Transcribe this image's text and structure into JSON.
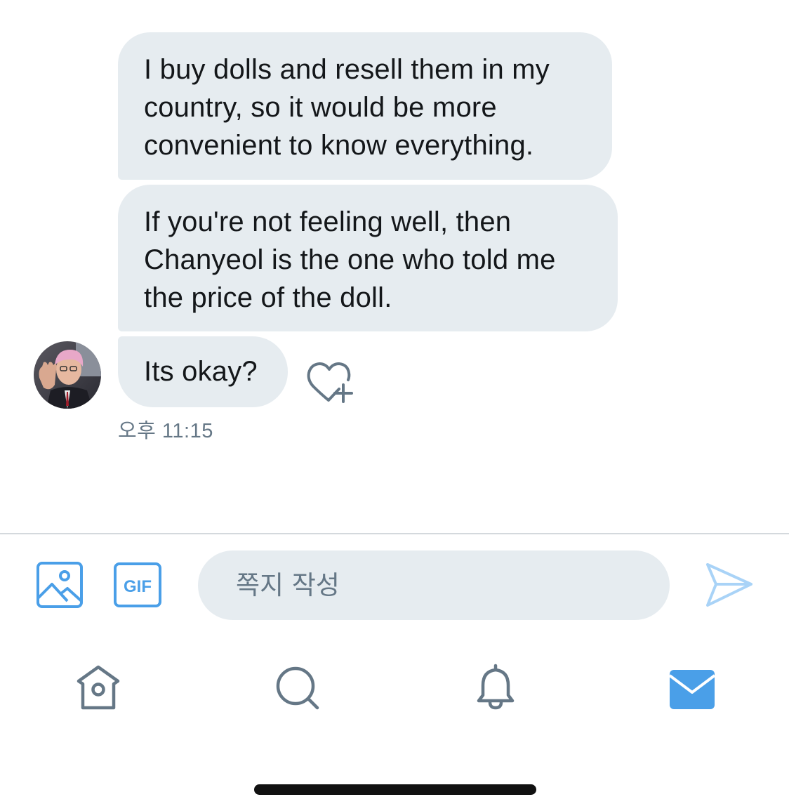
{
  "conversation": {
    "messages": [
      {
        "text": "I buy dolls and resell them in my country, so it would be more convenient to know everything."
      },
      {
        "text": "If you're not feeling well, then Chanyeol is the one who told me the price of the doll."
      },
      {
        "text": "Its okay?"
      }
    ],
    "timestamp": "오후 11:15",
    "avatar_icon": "user-avatar-photo",
    "like_icon": "heart-plus-icon"
  },
  "composer": {
    "image_icon": "image-icon",
    "gif_label": "GIF",
    "input_placeholder": "쪽지 작성",
    "input_value": "",
    "send_icon": "send-icon"
  },
  "tab_bar": {
    "items": [
      {
        "icon": "home-icon",
        "active": false
      },
      {
        "icon": "search-icon",
        "active": false
      },
      {
        "icon": "bell-icon",
        "active": false
      },
      {
        "icon": "mail-icon",
        "active": true
      }
    ]
  },
  "colors": {
    "accent": "#1da1f2",
    "icon_blue": "#4a9fe8",
    "bubble_bg": "#e6ecf0",
    "text_primary": "#14171a",
    "text_secondary": "#657786",
    "tab_inactive": "#657786"
  }
}
